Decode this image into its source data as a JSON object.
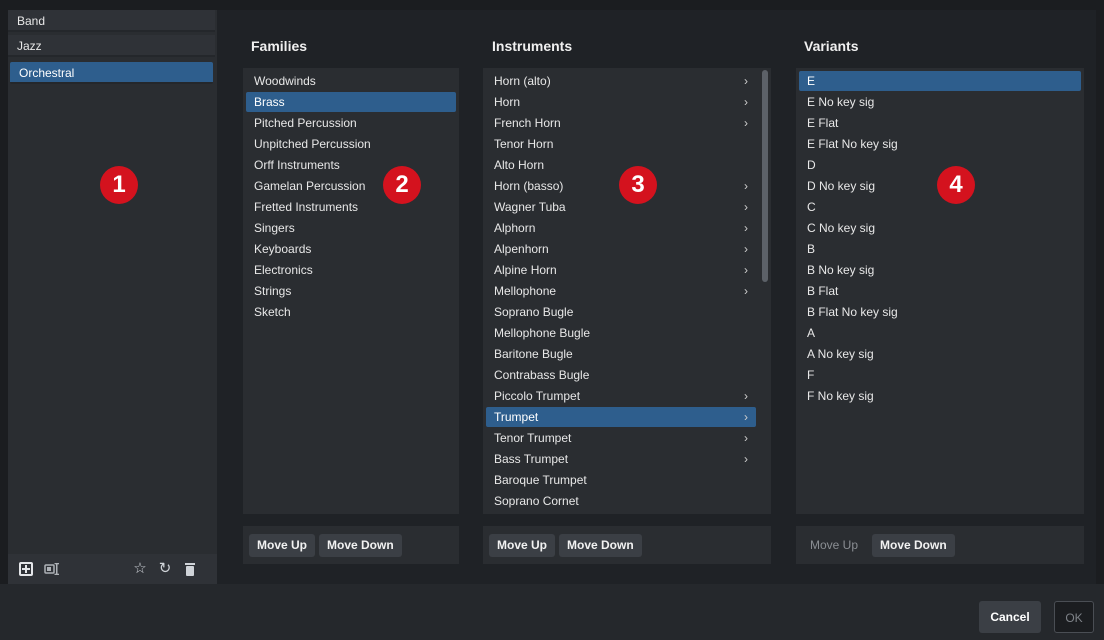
{
  "templates": [
    {
      "label": "Band",
      "selected": false
    },
    {
      "label": "Jazz",
      "selected": false
    },
    {
      "label": "Orchestral",
      "selected": true
    }
  ],
  "left_toolbar": {
    "icons": [
      "add-icon",
      "rename-icon",
      "star-icon",
      "revert-icon",
      "trash-icon"
    ]
  },
  "families": {
    "title": "Families",
    "items": [
      {
        "label": "Woodwinds",
        "selected": false
      },
      {
        "label": "Brass",
        "selected": true
      },
      {
        "label": "Pitched Percussion",
        "selected": false
      },
      {
        "label": "Unpitched Percussion",
        "selected": false
      },
      {
        "label": "Orff Instruments",
        "selected": false
      },
      {
        "label": "Gamelan Percussion",
        "selected": false
      },
      {
        "label": "Fretted Instruments",
        "selected": false
      },
      {
        "label": "Singers",
        "selected": false
      },
      {
        "label": "Keyboards",
        "selected": false
      },
      {
        "label": "Electronics",
        "selected": false
      },
      {
        "label": "Strings",
        "selected": false
      },
      {
        "label": "Sketch",
        "selected": false
      }
    ],
    "move_up": "Move Up",
    "move_down": "Move Down"
  },
  "instruments": {
    "title": "Instruments",
    "items": [
      {
        "label": "Horn (alto)",
        "has_variants": true,
        "selected": false
      },
      {
        "label": "Horn",
        "has_variants": true,
        "selected": false
      },
      {
        "label": "French Horn",
        "has_variants": true,
        "selected": false
      },
      {
        "label": "Tenor Horn",
        "has_variants": false,
        "selected": false
      },
      {
        "label": "Alto Horn",
        "has_variants": false,
        "selected": false
      },
      {
        "label": "Horn (basso)",
        "has_variants": true,
        "selected": false
      },
      {
        "label": "Wagner Tuba",
        "has_variants": true,
        "selected": false
      },
      {
        "label": "Alphorn",
        "has_variants": true,
        "selected": false
      },
      {
        "label": "Alpenhorn",
        "has_variants": true,
        "selected": false
      },
      {
        "label": "Alpine Horn",
        "has_variants": true,
        "selected": false
      },
      {
        "label": "Mellophone",
        "has_variants": true,
        "selected": false
      },
      {
        "label": "Soprano Bugle",
        "has_variants": false,
        "selected": false
      },
      {
        "label": "Mellophone Bugle",
        "has_variants": false,
        "selected": false
      },
      {
        "label": "Baritone Bugle",
        "has_variants": false,
        "selected": false
      },
      {
        "label": "Contrabass Bugle",
        "has_variants": false,
        "selected": false
      },
      {
        "label": "Piccolo Trumpet",
        "has_variants": true,
        "selected": false
      },
      {
        "label": "Trumpet",
        "has_variants": true,
        "selected": true
      },
      {
        "label": "Tenor Trumpet",
        "has_variants": true,
        "selected": false
      },
      {
        "label": "Bass Trumpet",
        "has_variants": true,
        "selected": false
      },
      {
        "label": "Baroque Trumpet",
        "has_variants": false,
        "selected": false
      },
      {
        "label": "Soprano Cornet",
        "has_variants": false,
        "selected": false
      }
    ],
    "move_up": "Move Up",
    "move_down": "Move Down"
  },
  "variants": {
    "title": "Variants",
    "items": [
      {
        "label": "E",
        "selected": true
      },
      {
        "label": "E No key sig",
        "selected": false
      },
      {
        "label": "E Flat",
        "selected": false
      },
      {
        "label": "E Flat No key sig",
        "selected": false
      },
      {
        "label": "D",
        "selected": false
      },
      {
        "label": "D No key sig",
        "selected": false
      },
      {
        "label": "C",
        "selected": false
      },
      {
        "label": "C No key sig",
        "selected": false
      },
      {
        "label": "B",
        "selected": false
      },
      {
        "label": "B No key sig",
        "selected": false
      },
      {
        "label": "B Flat",
        "selected": false
      },
      {
        "label": "B Flat No key sig",
        "selected": false
      },
      {
        "label": "A",
        "selected": false
      },
      {
        "label": "A No key sig",
        "selected": false
      },
      {
        "label": "F",
        "selected": false
      },
      {
        "label": "F No key sig",
        "selected": false
      }
    ],
    "move_up": "Move Up",
    "move_down": "Move Down",
    "move_up_disabled": true
  },
  "callouts": [
    "1",
    "2",
    "3",
    "4"
  ],
  "dialog_buttons": {
    "cancel": "Cancel",
    "ok": "OK"
  },
  "colors": {
    "selection": "#2e5e8d",
    "callout": "#d4121e",
    "panel": "#2a2d31"
  }
}
